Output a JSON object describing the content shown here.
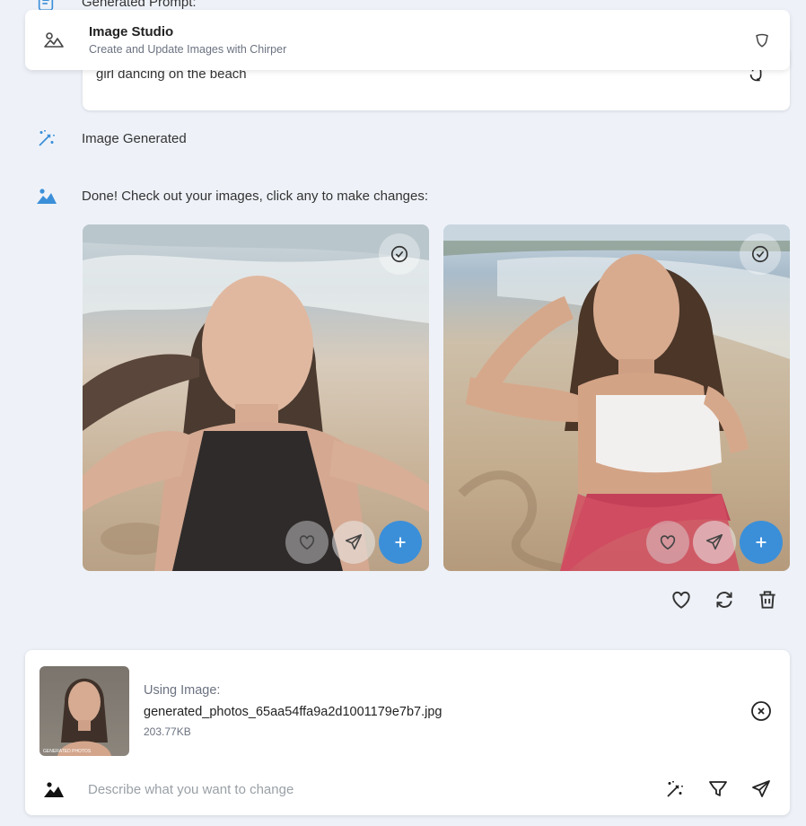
{
  "chat": {
    "generated_prompt_label": "Generated Prompt:",
    "prompt_text": "girl dancing on the beach",
    "image_generated_label": "Image Generated",
    "done_message": "Done! Check out your images, click any to make changes:"
  },
  "header": {
    "title": "Image Studio",
    "subtitle": "Create and Update Images with Chirper"
  },
  "composer": {
    "using_label": "Using Image:",
    "file_name": "generated_photos_65aa54ffa9a2d1001179e7b7.jpg",
    "file_size": "203.77KB",
    "thumb_caption": "GENERATED PHOTOS",
    "placeholder": "Describe what you want to change"
  },
  "colors": {
    "accent": "#3b8fd9",
    "background": "#eef2f8"
  },
  "icons": [
    "document-icon",
    "copy-icon",
    "mountains-icon",
    "shield-icon",
    "magic-wand-icon",
    "image-icon",
    "check-circle-icon",
    "heart-icon",
    "send-icon",
    "plus-icon",
    "refresh-icon",
    "trash-icon",
    "close-circle-icon",
    "funnel-icon"
  ]
}
